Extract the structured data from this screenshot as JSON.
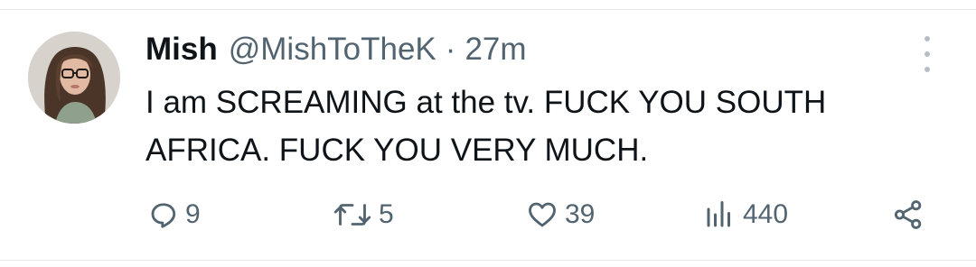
{
  "tweet": {
    "author_name": "Mish",
    "handle": "@MishToTheK",
    "separator": "·",
    "time": "27m",
    "text": "I am SCREAMING at the tv. FUCK YOU SOUTH AFRICA. FUCK YOU VERY MUCH."
  },
  "actions": {
    "replies": "9",
    "retweets": "5",
    "likes": "39",
    "views": "440"
  },
  "icons": {
    "reply": "reply-icon",
    "retweet": "retweet-icon",
    "like": "heart-icon",
    "views": "views-icon",
    "share": "share-icon",
    "more": "more-options-icon"
  },
  "colors": {
    "text_primary": "#0f1419",
    "text_secondary": "#536471",
    "divider": "#e6e9ec"
  }
}
